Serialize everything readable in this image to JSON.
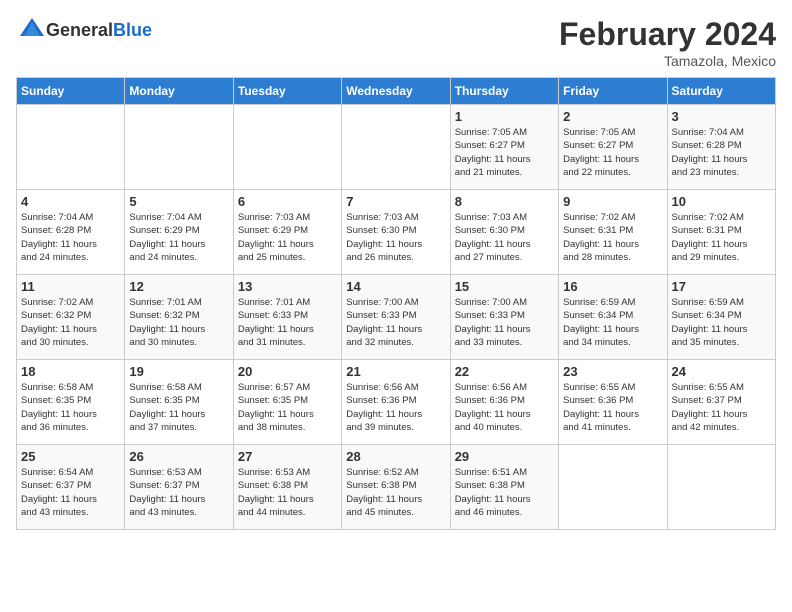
{
  "header": {
    "logo_general": "General",
    "logo_blue": "Blue",
    "month_title": "February 2024",
    "location": "Tamazola, Mexico"
  },
  "days_of_week": [
    "Sunday",
    "Monday",
    "Tuesday",
    "Wednesday",
    "Thursday",
    "Friday",
    "Saturday"
  ],
  "weeks": [
    [
      {
        "day": "",
        "info": ""
      },
      {
        "day": "",
        "info": ""
      },
      {
        "day": "",
        "info": ""
      },
      {
        "day": "",
        "info": ""
      },
      {
        "day": "1",
        "info": "Sunrise: 7:05 AM\nSunset: 6:27 PM\nDaylight: 11 hours\nand 21 minutes."
      },
      {
        "day": "2",
        "info": "Sunrise: 7:05 AM\nSunset: 6:27 PM\nDaylight: 11 hours\nand 22 minutes."
      },
      {
        "day": "3",
        "info": "Sunrise: 7:04 AM\nSunset: 6:28 PM\nDaylight: 11 hours\nand 23 minutes."
      }
    ],
    [
      {
        "day": "4",
        "info": "Sunrise: 7:04 AM\nSunset: 6:28 PM\nDaylight: 11 hours\nand 24 minutes."
      },
      {
        "day": "5",
        "info": "Sunrise: 7:04 AM\nSunset: 6:29 PM\nDaylight: 11 hours\nand 24 minutes."
      },
      {
        "day": "6",
        "info": "Sunrise: 7:03 AM\nSunset: 6:29 PM\nDaylight: 11 hours\nand 25 minutes."
      },
      {
        "day": "7",
        "info": "Sunrise: 7:03 AM\nSunset: 6:30 PM\nDaylight: 11 hours\nand 26 minutes."
      },
      {
        "day": "8",
        "info": "Sunrise: 7:03 AM\nSunset: 6:30 PM\nDaylight: 11 hours\nand 27 minutes."
      },
      {
        "day": "9",
        "info": "Sunrise: 7:02 AM\nSunset: 6:31 PM\nDaylight: 11 hours\nand 28 minutes."
      },
      {
        "day": "10",
        "info": "Sunrise: 7:02 AM\nSunset: 6:31 PM\nDaylight: 11 hours\nand 29 minutes."
      }
    ],
    [
      {
        "day": "11",
        "info": "Sunrise: 7:02 AM\nSunset: 6:32 PM\nDaylight: 11 hours\nand 30 minutes."
      },
      {
        "day": "12",
        "info": "Sunrise: 7:01 AM\nSunset: 6:32 PM\nDaylight: 11 hours\nand 30 minutes."
      },
      {
        "day": "13",
        "info": "Sunrise: 7:01 AM\nSunset: 6:33 PM\nDaylight: 11 hours\nand 31 minutes."
      },
      {
        "day": "14",
        "info": "Sunrise: 7:00 AM\nSunset: 6:33 PM\nDaylight: 11 hours\nand 32 minutes."
      },
      {
        "day": "15",
        "info": "Sunrise: 7:00 AM\nSunset: 6:33 PM\nDaylight: 11 hours\nand 33 minutes."
      },
      {
        "day": "16",
        "info": "Sunrise: 6:59 AM\nSunset: 6:34 PM\nDaylight: 11 hours\nand 34 minutes."
      },
      {
        "day": "17",
        "info": "Sunrise: 6:59 AM\nSunset: 6:34 PM\nDaylight: 11 hours\nand 35 minutes."
      }
    ],
    [
      {
        "day": "18",
        "info": "Sunrise: 6:58 AM\nSunset: 6:35 PM\nDaylight: 11 hours\nand 36 minutes."
      },
      {
        "day": "19",
        "info": "Sunrise: 6:58 AM\nSunset: 6:35 PM\nDaylight: 11 hours\nand 37 minutes."
      },
      {
        "day": "20",
        "info": "Sunrise: 6:57 AM\nSunset: 6:35 PM\nDaylight: 11 hours\nand 38 minutes."
      },
      {
        "day": "21",
        "info": "Sunrise: 6:56 AM\nSunset: 6:36 PM\nDaylight: 11 hours\nand 39 minutes."
      },
      {
        "day": "22",
        "info": "Sunrise: 6:56 AM\nSunset: 6:36 PM\nDaylight: 11 hours\nand 40 minutes."
      },
      {
        "day": "23",
        "info": "Sunrise: 6:55 AM\nSunset: 6:36 PM\nDaylight: 11 hours\nand 41 minutes."
      },
      {
        "day": "24",
        "info": "Sunrise: 6:55 AM\nSunset: 6:37 PM\nDaylight: 11 hours\nand 42 minutes."
      }
    ],
    [
      {
        "day": "25",
        "info": "Sunrise: 6:54 AM\nSunset: 6:37 PM\nDaylight: 11 hours\nand 43 minutes."
      },
      {
        "day": "26",
        "info": "Sunrise: 6:53 AM\nSunset: 6:37 PM\nDaylight: 11 hours\nand 43 minutes."
      },
      {
        "day": "27",
        "info": "Sunrise: 6:53 AM\nSunset: 6:38 PM\nDaylight: 11 hours\nand 44 minutes."
      },
      {
        "day": "28",
        "info": "Sunrise: 6:52 AM\nSunset: 6:38 PM\nDaylight: 11 hours\nand 45 minutes."
      },
      {
        "day": "29",
        "info": "Sunrise: 6:51 AM\nSunset: 6:38 PM\nDaylight: 11 hours\nand 46 minutes."
      },
      {
        "day": "",
        "info": ""
      },
      {
        "day": "",
        "info": ""
      }
    ]
  ]
}
